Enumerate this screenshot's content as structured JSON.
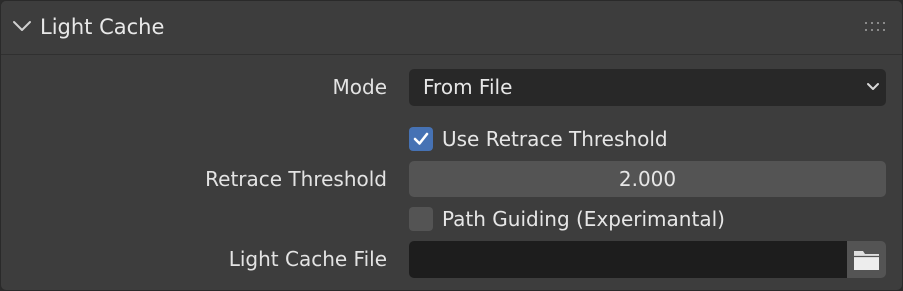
{
  "panel": {
    "title": "Light Cache",
    "expanded": true,
    "icons": {
      "collapse": "chevron-down-icon",
      "drag": "drag-handle-icon"
    }
  },
  "fields": {
    "mode": {
      "label": "Mode",
      "value": "From File"
    },
    "use_retrace_threshold": {
      "label": "Use Retrace Threshold",
      "checked": true
    },
    "retrace_threshold": {
      "label": "Retrace Threshold",
      "value": "2.000"
    },
    "path_guiding": {
      "label": "Path Guiding (Experimantal)",
      "checked": false
    },
    "light_cache_file": {
      "label": "Light Cache File",
      "value": "",
      "icon": "folder-icon"
    }
  },
  "colors": {
    "panel_bg": "#3d3d3d",
    "field_dark": "#282828",
    "field_mid": "#545454",
    "accent": "#4672b4"
  }
}
